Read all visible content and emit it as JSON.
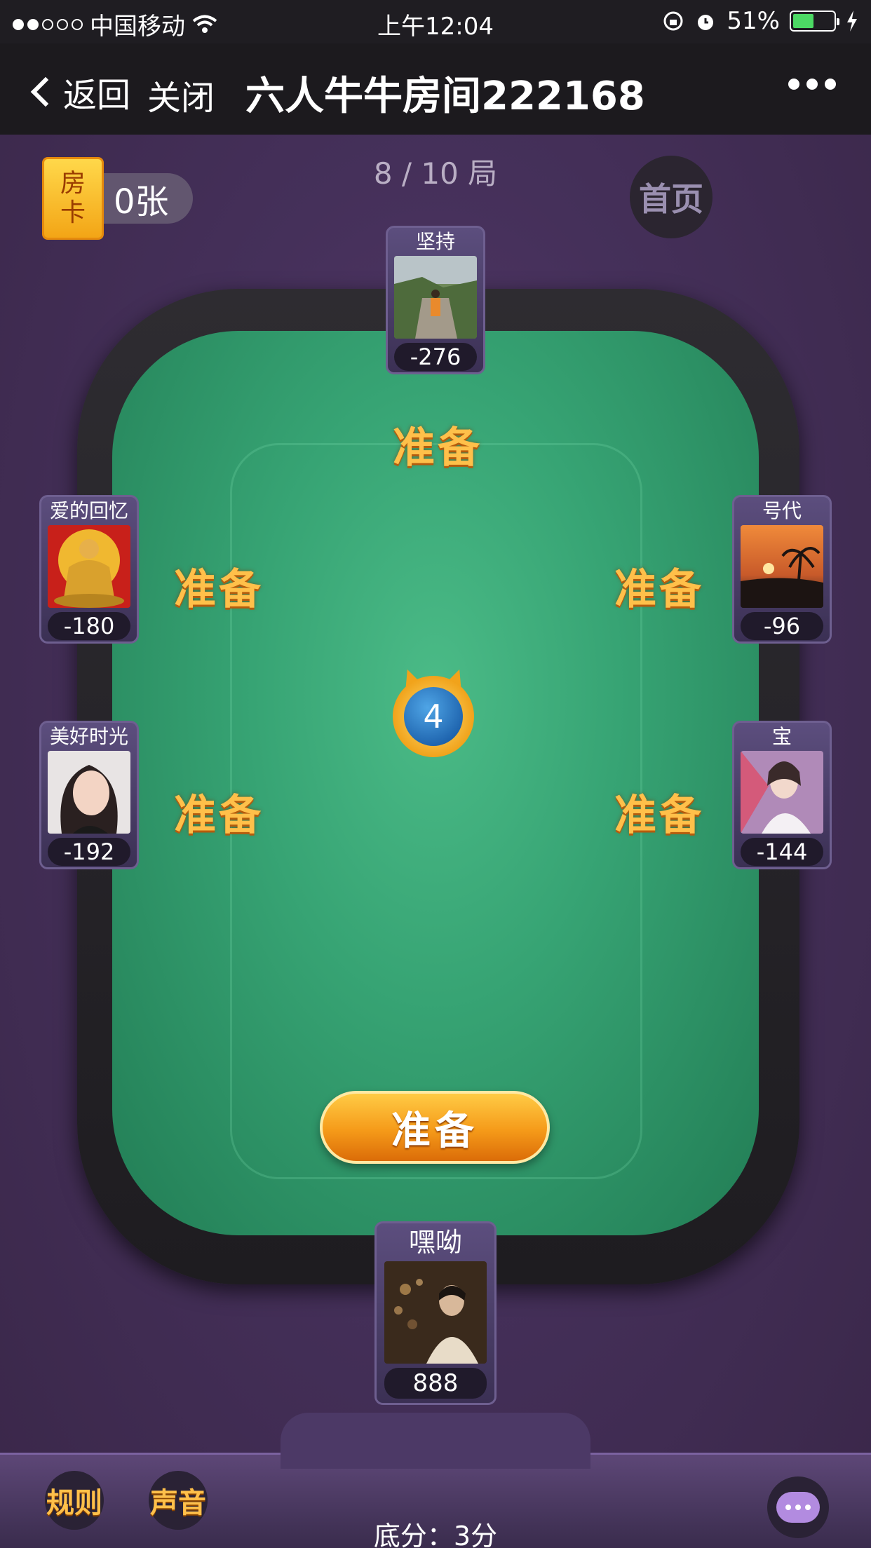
{
  "status_bar": {
    "carrier": "中国移动",
    "time": "上午12:04",
    "battery": "51%",
    "signal_bars_on": 2,
    "signal_bars_total": 5
  },
  "nav": {
    "back_label": "返回",
    "close_label": "关闭",
    "title": "六人牛牛房间222168"
  },
  "game": {
    "room_card_badge": "房卡",
    "room_card_badge_top": "房",
    "room_card_badge_bottom": "卡",
    "room_card_count": "0张",
    "round": "8 / 10 局",
    "home_label": "首页",
    "countdown": "4",
    "ready_status": "准备",
    "ready_button": "准备",
    "base_score": "底分：3分"
  },
  "players": {
    "top": {
      "name": "坚持",
      "score": "-276"
    },
    "left_upper": {
      "name": "爱的回忆",
      "score": "-180"
    },
    "right_upper": {
      "name": "号代",
      "score": "-96"
    },
    "left_lower": {
      "name": "美好时光",
      "score": "-192"
    },
    "right_lower": {
      "name": "宝",
      "score": "-144"
    },
    "me": {
      "name": "嘿呦",
      "score": "888"
    }
  },
  "footer": {
    "rules_label": "规则",
    "sound_label": "声音"
  },
  "colors": {
    "felt": "#37a474",
    "accent_orange": "#f59a19",
    "panel_purple": "#5c4e7e",
    "background": "#3b2747"
  }
}
